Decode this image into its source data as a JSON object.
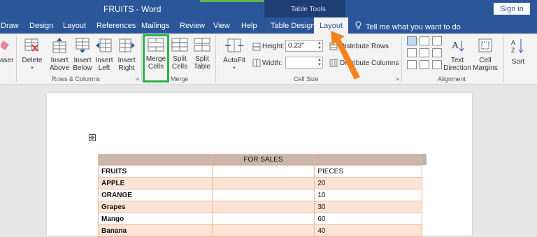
{
  "titlebar": {
    "doc_title": "FRUITS  -  Word",
    "context_label": "Table Tools",
    "signin": "Sign in"
  },
  "tabs": [
    {
      "label": "Draw"
    },
    {
      "label": "Design"
    },
    {
      "label": "Layout"
    },
    {
      "label": "References"
    },
    {
      "label": "Mailings"
    },
    {
      "label": "Review"
    },
    {
      "label": "View"
    },
    {
      "label": "Help"
    },
    {
      "label": "Table Design"
    },
    {
      "label": "Layout"
    }
  ],
  "tell_me": "Tell me what you want to do",
  "ribbon": {
    "eraser": "aser",
    "delete": "Delete",
    "insert_above": [
      "Insert",
      "Above"
    ],
    "insert_below": [
      "Insert",
      "Below"
    ],
    "insert_left": [
      "Insert",
      "Left"
    ],
    "insert_right": [
      "Insert",
      "Right"
    ],
    "rows_columns": "Rows & Columns",
    "merge_cells": [
      "Merge",
      "Cells"
    ],
    "split_cells": [
      "Split",
      "Cells"
    ],
    "split_table": [
      "Split",
      "Table"
    ],
    "merge_group": "Merge",
    "autofit": "AutoFit",
    "height_label": "Height:",
    "height_value": "0.23\"",
    "width_label": "Width:",
    "width_value": "",
    "distribute_rows": "Distribute Rows",
    "distribute_columns": "Distribute Columns",
    "cell_size": "Cell Size",
    "text_direction": [
      "Text",
      "Direction"
    ],
    "cell_margins": [
      "Cell",
      "Margins"
    ],
    "alignment": "Alignment",
    "sort": "Sort"
  },
  "table": {
    "header": "FOR SALES",
    "rows": [
      {
        "c1": "FRUITS",
        "c2": "",
        "c3": "PIECES"
      },
      {
        "c1": "APPLE",
        "c2": "",
        "c3": "20"
      },
      {
        "c1": "ORANGE",
        "c2": "",
        "c3": "10"
      },
      {
        "c1": "Grapes",
        "c2": "",
        "c3": "30"
      },
      {
        "c1": "Mango",
        "c2": "",
        "c3": "60"
      },
      {
        "c1": "Banana",
        "c2": "",
        "c3": "40"
      }
    ]
  },
  "colors": {
    "word_blue": "#2b579a",
    "highlight_green": "#2bb34a",
    "arrow_orange": "#f58220",
    "row_shade": "#fbe4d5"
  }
}
